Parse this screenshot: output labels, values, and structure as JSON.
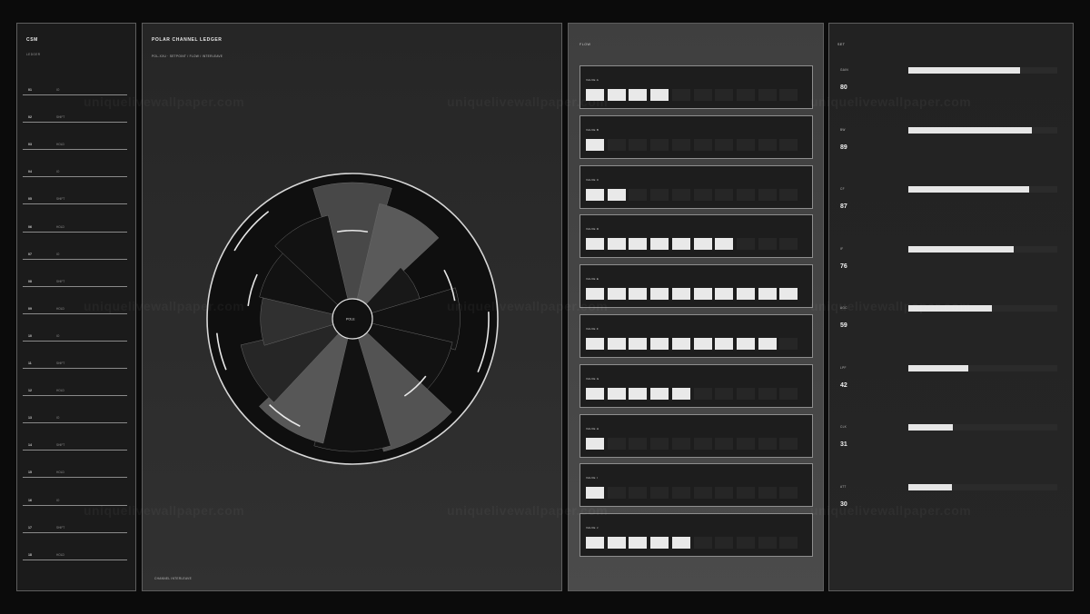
{
  "ledger": {
    "title": "CSM",
    "subtitle": "LEDGER",
    "rows": [
      {
        "idx": "01",
        "tag": "IO"
      },
      {
        "idx": "02",
        "tag": "SHIFT"
      },
      {
        "idx": "03",
        "tag": "HOLD"
      },
      {
        "idx": "04",
        "tag": "IO"
      },
      {
        "idx": "05",
        "tag": "SHIFT"
      },
      {
        "idx": "06",
        "tag": "HOLD"
      },
      {
        "idx": "07",
        "tag": "IO"
      },
      {
        "idx": "08",
        "tag": "SHIFT"
      },
      {
        "idx": "09",
        "tag": "HOLD"
      },
      {
        "idx": "10",
        "tag": "IO"
      },
      {
        "idx": "11",
        "tag": "SHIFT"
      },
      {
        "idx": "12",
        "tag": "HOLD"
      },
      {
        "idx": "13",
        "tag": "IO"
      },
      {
        "idx": "14",
        "tag": "SHIFT"
      },
      {
        "idx": "15",
        "tag": "HOLD"
      },
      {
        "idx": "16",
        "tag": "IO"
      },
      {
        "idx": "17",
        "tag": "SHIFT"
      },
      {
        "idx": "18",
        "tag": "HOLD"
      }
    ]
  },
  "polar": {
    "title": "POLAR CHANNEL LEDGER",
    "subtitle": "POL-XXU · SETPOINT / FLOW / INTERLEAVE",
    "hub_label": "POLE",
    "footer": "CHANNEL INTERLEAVE",
    "sector_levels": [
      0.97,
      0.82,
      0.42,
      0.73,
      0.69,
      0.97,
      0.94,
      0.9,
      0.79,
      0.6,
      0.63,
      0.72
    ],
    "sector_shades": [
      "#484848",
      "#5a5a5a",
      "#181818",
      "#121212",
      "#121212",
      "#535353",
      "#121212",
      "#575757",
      "#262626",
      "#303030",
      "#121212",
      "#121212"
    ],
    "markers": [
      {
        "start": 350,
        "end": 10,
        "level": 0.57
      },
      {
        "start": 62,
        "end": 80,
        "level": 0.7
      },
      {
        "start": 128,
        "end": 146,
        "level": 0.61
      },
      {
        "start": 206,
        "end": 224,
        "level": 0.83
      },
      {
        "start": 277,
        "end": 295,
        "level": 0.71
      },
      {
        "start": 300,
        "end": 322,
        "level": 0.97
      },
      {
        "start": 87,
        "end": 113,
        "level": 0.97
      },
      {
        "start": 248,
        "end": 264,
        "level": 0.97
      }
    ]
  },
  "flow": {
    "title": "FLOW",
    "segments_total": 10,
    "items": [
      {
        "label": "VALVE A",
        "active": 4
      },
      {
        "label": "VALVE B",
        "active": 1
      },
      {
        "label": "VALVE C",
        "active": 2
      },
      {
        "label": "VALVE D",
        "active": 7
      },
      {
        "label": "VALVE E",
        "active": 10
      },
      {
        "label": "VALVE F",
        "active": 9
      },
      {
        "label": "VALVE G",
        "active": 5
      },
      {
        "label": "VALVE H",
        "active": 1
      },
      {
        "label": "VALVE I",
        "active": 1
      },
      {
        "label": "VALVE J",
        "active": 5
      }
    ]
  },
  "set": {
    "title": "SET",
    "items": [
      {
        "name": "GAIN",
        "value": "80",
        "level": 0.75
      },
      {
        "name": "BW",
        "value": "89",
        "level": 0.83
      },
      {
        "name": "CF",
        "value": "87",
        "level": 0.81
      },
      {
        "name": "IF",
        "value": "76",
        "level": 0.71
      },
      {
        "name": "AGC",
        "value": "59",
        "level": 0.56
      },
      {
        "name": "LPF",
        "value": "42",
        "level": 0.4
      },
      {
        "name": "CLK",
        "value": "31",
        "level": 0.3
      },
      {
        "name": "ATT",
        "value": "30",
        "level": 0.29
      }
    ]
  },
  "watermark": "uniquelivewallpaper.com"
}
